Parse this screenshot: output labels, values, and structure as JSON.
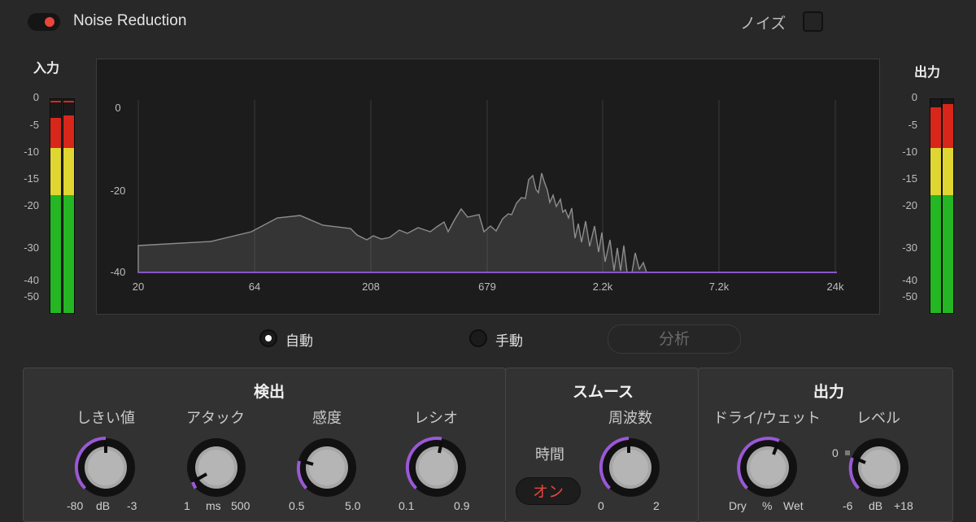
{
  "header": {
    "title": "Noise Reduction",
    "power_state": "on",
    "noise_label": "ノイズ",
    "noise_checked": false
  },
  "input_meter": {
    "title": "入力",
    "scale": [
      "0",
      "-5",
      "-10",
      "-15",
      "-20",
      "-30",
      "-40",
      "-50"
    ]
  },
  "output_meter": {
    "title": "出力",
    "scale": [
      "0",
      "-5",
      "-10",
      "-15",
      "-20",
      "-30",
      "-40",
      "-50"
    ]
  },
  "spectrum": {
    "y_labels": [
      "0",
      "-20",
      "-40"
    ],
    "x_labels": [
      "20",
      "64",
      "208",
      "679",
      "2.2k",
      "7.2k",
      "24k"
    ]
  },
  "mode": {
    "auto_label": "自動",
    "manual_label": "手動",
    "selected": "auto",
    "analyze_label": "分析"
  },
  "detection": {
    "title": "検出",
    "threshold": {
      "label": "しきい値",
      "min": "-80",
      "unit": "dB",
      "max": "-3"
    },
    "attack": {
      "label": "アタック",
      "min": "1",
      "unit": "ms",
      "max": "500"
    },
    "sensitivity": {
      "label": "感度",
      "min": "0.5",
      "max": "5.0"
    },
    "ratio": {
      "label": "レシオ",
      "min": "0.1",
      "max": "0.9"
    }
  },
  "smooth": {
    "title": "スムース",
    "frequency": {
      "label": "周波数",
      "min": "0",
      "max": "2"
    },
    "time_label": "時間",
    "time_toggle": "オン"
  },
  "output": {
    "title": "出力",
    "dry_wet": {
      "label": "ドライ/ウェット",
      "min": "Dry",
      "unit": "%",
      "max": "Wet"
    },
    "level": {
      "label": "レベル",
      "min": "-6",
      "unit": "dB",
      "max": "+18",
      "zero": "0"
    }
  }
}
